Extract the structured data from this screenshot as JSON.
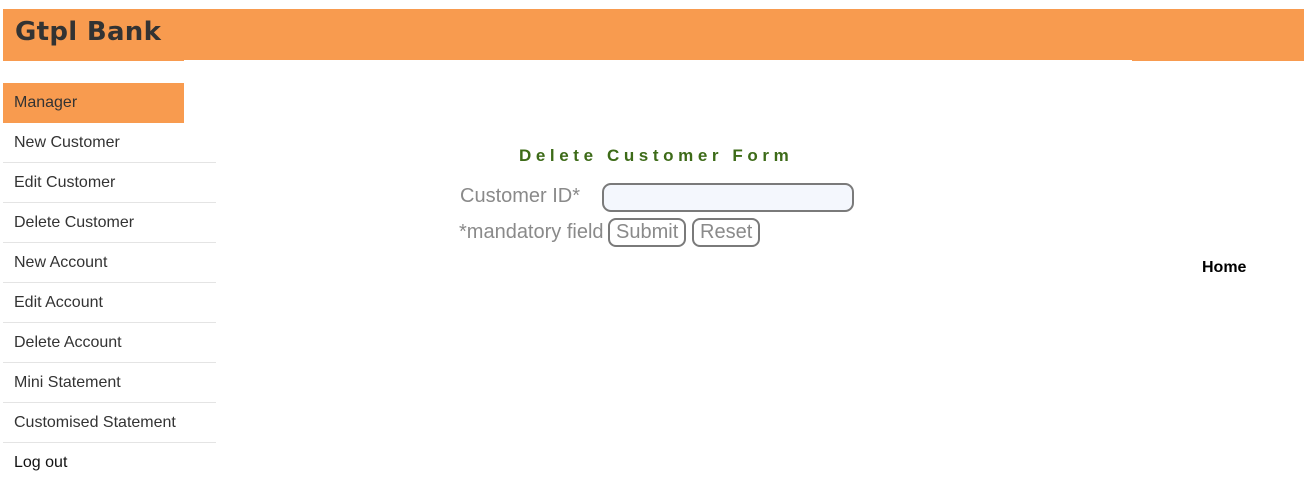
{
  "header": {
    "brand": "Gtpl Bank"
  },
  "sidebar": {
    "items": [
      {
        "label": "Manager"
      },
      {
        "label": "New Customer"
      },
      {
        "label": "Edit Customer"
      },
      {
        "label": "Delete Customer"
      },
      {
        "label": "New Account"
      },
      {
        "label": "Edit Account"
      },
      {
        "label": "Delete Account"
      },
      {
        "label": "Mini Statement"
      },
      {
        "label": "Customised Statement"
      },
      {
        "label": "Log out"
      }
    ]
  },
  "form": {
    "title": "Delete Customer Form",
    "customer_id_label": "Customer ID*",
    "customer_id_value": "",
    "mandatory_note": "*mandatory field",
    "submit_label": "Submit",
    "reset_label": "Reset"
  },
  "footer": {
    "home_label": "Home"
  },
  "colors": {
    "accent": "#f89b4f",
    "form_title": "#3d6b18",
    "muted_text": "#8a8a8a"
  }
}
